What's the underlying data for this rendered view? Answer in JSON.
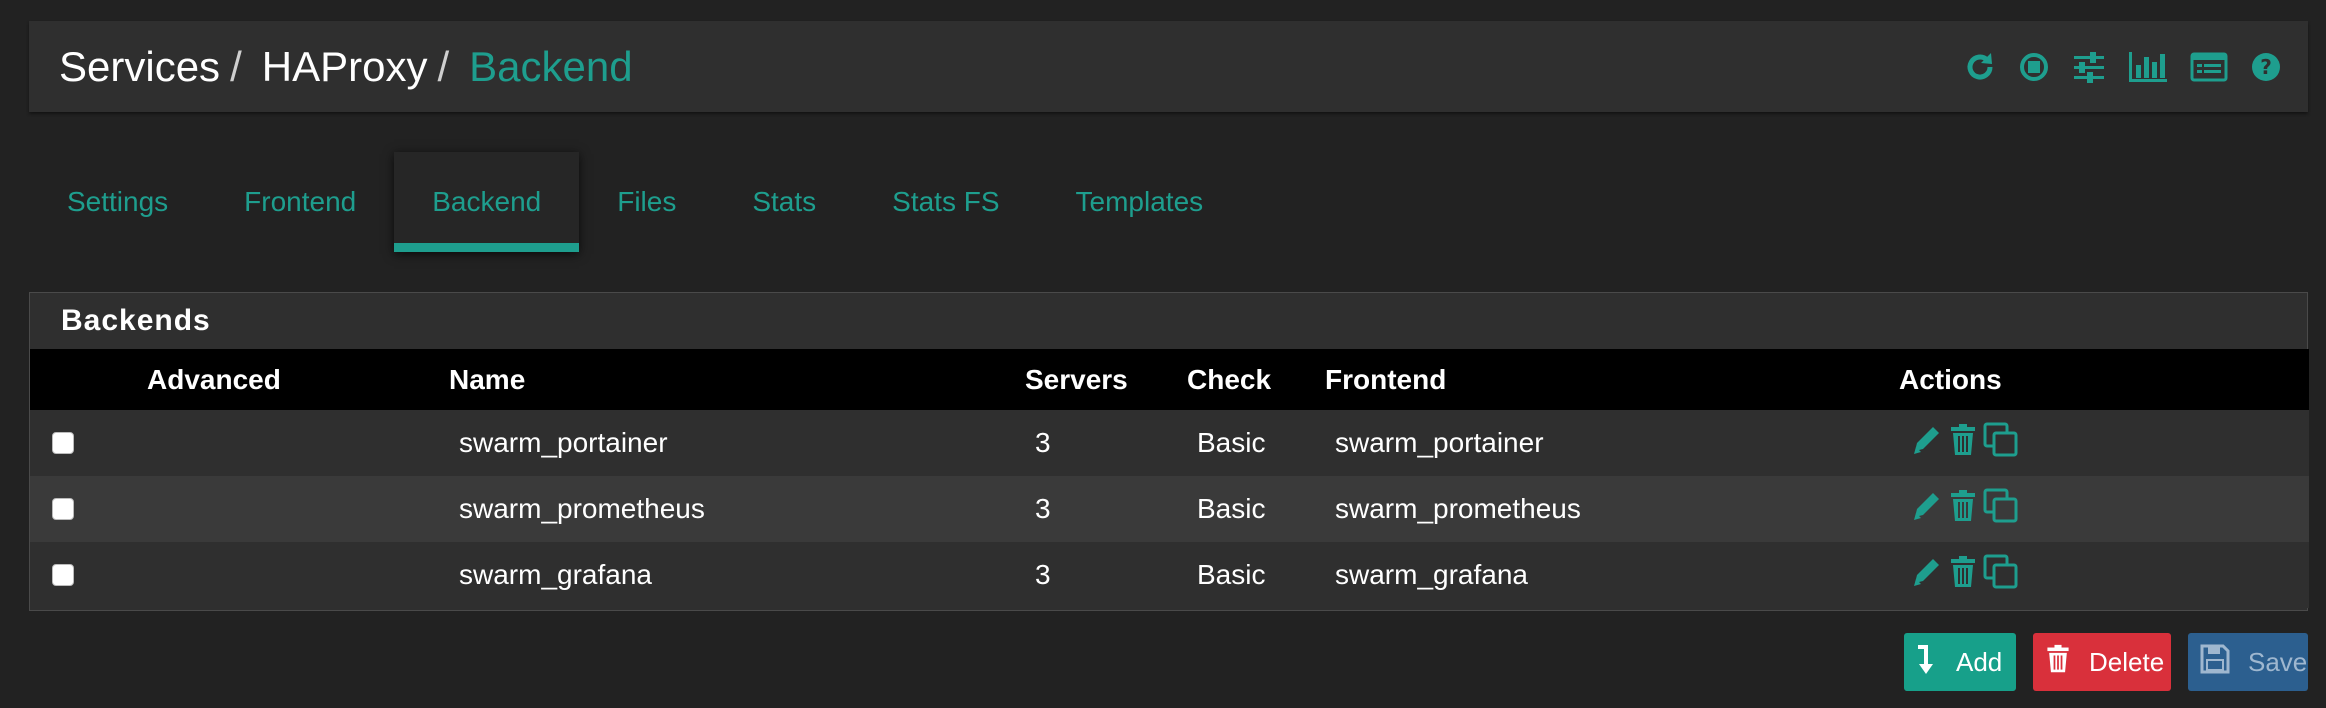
{
  "breadcrumb": [
    "Services",
    "HAProxy",
    "Backend"
  ],
  "header_icons": [
    "reload-icon",
    "stop-icon",
    "sliders-icon",
    "bar-chart-icon",
    "log-list-icon",
    "help-icon"
  ],
  "tabs": [
    {
      "label": "Settings",
      "active": false
    },
    {
      "label": "Frontend",
      "active": false
    },
    {
      "label": "Backend",
      "active": true
    },
    {
      "label": "Files",
      "active": false
    },
    {
      "label": "Stats",
      "active": false
    },
    {
      "label": "Stats FS",
      "active": false
    },
    {
      "label": "Templates",
      "active": false
    }
  ],
  "panel": {
    "title": "Backends",
    "columns": [
      "Advanced",
      "Name",
      "Servers",
      "Check",
      "Frontend",
      "Actions"
    ],
    "rows": [
      {
        "name": "swarm_portainer",
        "servers": "3",
        "check": "Basic",
        "frontend": "swarm_portainer"
      },
      {
        "name": "swarm_prometheus",
        "servers": "3",
        "check": "Basic",
        "frontend": "swarm_prometheus"
      },
      {
        "name": "swarm_grafana",
        "servers": "3",
        "check": "Basic",
        "frontend": "swarm_grafana"
      }
    ]
  },
  "buttons": {
    "add": "Add",
    "delete": "Delete",
    "save": "Save"
  },
  "colors": {
    "accent": "#1e9e8e",
    "add": "#17a08a",
    "delete": "#d9303b",
    "save": "#2c5f8f"
  }
}
